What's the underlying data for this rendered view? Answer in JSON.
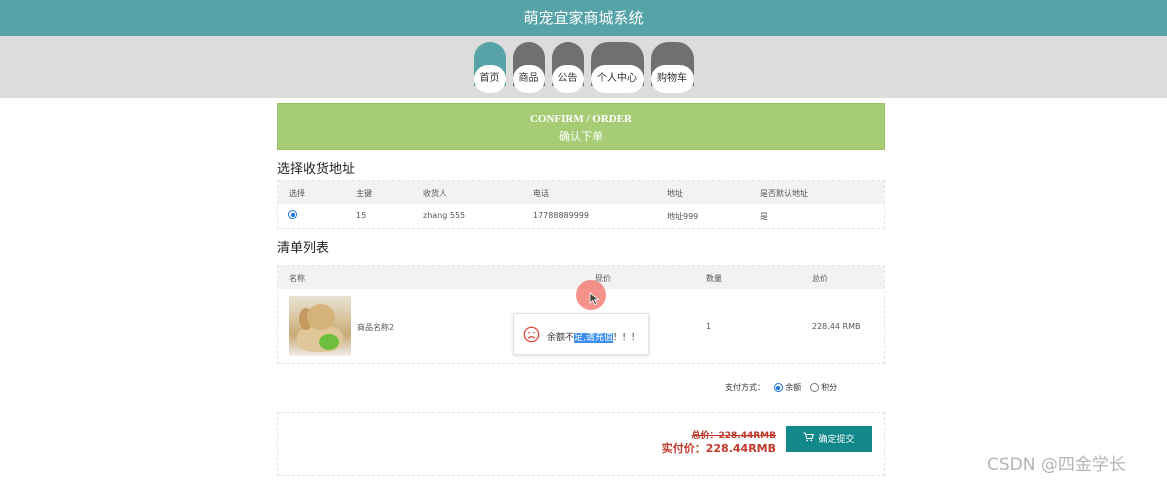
{
  "header": {
    "title": "萌宠宜家商城系统"
  },
  "nav": [
    {
      "label": "首页",
      "active": true
    },
    {
      "label": "商品",
      "active": false
    },
    {
      "label": "公告",
      "active": false
    },
    {
      "label": "个人中心",
      "active": false
    },
    {
      "label": "购物车",
      "active": false
    }
  ],
  "banner": {
    "en": "CONFIRM / ORDER",
    "cn": "确认下单"
  },
  "address": {
    "title": "选择收货地址",
    "headers": [
      "选择",
      "主键",
      "收货人",
      "电话",
      "地址",
      "是否默认地址"
    ],
    "rows": [
      {
        "selected": true,
        "id": "15",
        "name": "zhang 555",
        "phone": "17788889999",
        "address": "地址999",
        "is_default": "是"
      }
    ]
  },
  "order": {
    "title": "清单列表",
    "headers": [
      "名称",
      "现价",
      "数量",
      "总价"
    ],
    "items": [
      {
        "image_icon": "product-dog-photo",
        "name": "商品名称2",
        "quantity": "1",
        "total": "228.44 RMB"
      }
    ]
  },
  "popup": {
    "icon": "sad-face-icon",
    "text_before": "余额不",
    "text_selected": "足,请充值",
    "text_after": "！！！"
  },
  "payment": {
    "label": "支付方式：",
    "options": [
      {
        "label": "余额",
        "selected": true
      },
      {
        "label": "积分",
        "selected": false
      }
    ]
  },
  "summary": {
    "total_strike": "总价：228.44RMB",
    "actual_label": "实付价：228.44RMB",
    "submit_label": "确定提交",
    "submit_icon": "cart-icon"
  },
  "watermark": "CSDN @四金学长",
  "colors": {
    "header": "#56a3a8",
    "banner": "#a6cd76",
    "price": "#c0392b",
    "button": "#13888b"
  }
}
